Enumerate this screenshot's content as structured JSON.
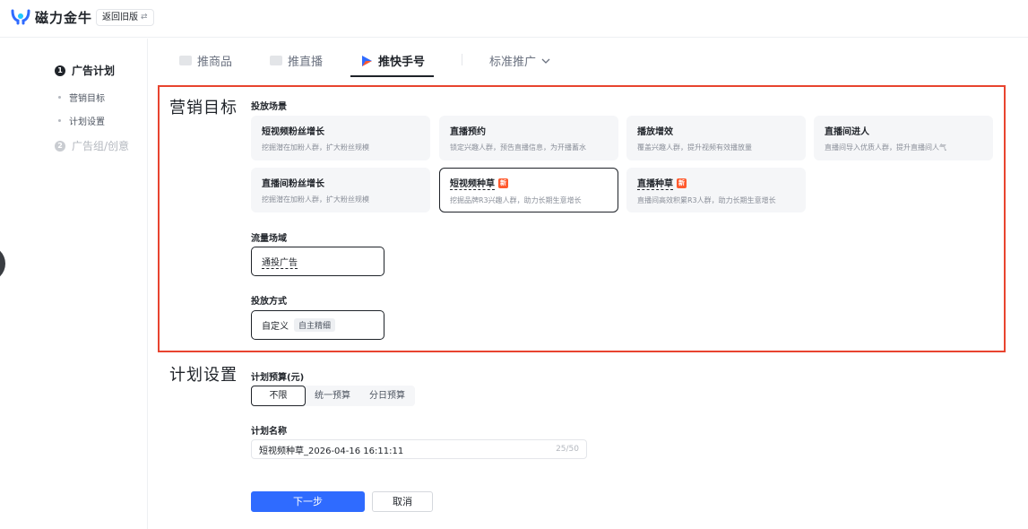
{
  "app": {
    "name": "磁力金牛",
    "back_old_label": "返回旧版",
    "swap_icon": "⇄"
  },
  "sidebar": {
    "step1": {
      "num": "1",
      "label": "广告计划"
    },
    "step1_items": [
      {
        "label": "营销目标"
      },
      {
        "label": "计划设置"
      }
    ],
    "step2": {
      "num": "2",
      "label": "广告组/创意"
    }
  },
  "tabs": [
    {
      "label": "推商品",
      "icon": "product-icon"
    },
    {
      "label": "推直播",
      "icon": "live-icon"
    },
    {
      "label": "推快手号",
      "icon": "kuaishou-icon"
    }
  ],
  "promo_mode": {
    "label": "标准推广",
    "icon": "chevron-down-icon"
  },
  "marketing_goal": {
    "title": "营销目标",
    "scene_label": "投放场景",
    "scenes": [
      {
        "title": "短视频粉丝增长",
        "desc": "挖掘潜在加粉人群，扩大粉丝规模",
        "new": ""
      },
      {
        "title": "直播预约",
        "desc": "锁定兴趣人群，预告直播信息，为开播蓄水",
        "new": ""
      },
      {
        "title": "播放增效",
        "desc": "覆盖兴趣人群，提升视频有效播放量",
        "new": ""
      },
      {
        "title": "直播间进人",
        "desc": "直播间导入优质人群，提升直播间人气",
        "new": ""
      },
      {
        "title": "直播间粉丝增长",
        "desc": "挖掘潜在加粉人群，扩大粉丝规模",
        "new": ""
      },
      {
        "title": "短视频种草",
        "desc": "挖掘品牌R3兴趣人群，助力长期生意增长",
        "new": "新"
      },
      {
        "title": "直播种草",
        "desc": "直播间高效积累R3人群，助力长期生意增长",
        "new": "新"
      }
    ],
    "traffic_label": "流量场域",
    "traffic_value": "通投广告",
    "delivery_label": "投放方式",
    "delivery_value": "自定义",
    "delivery_chip": "自主精细"
  },
  "plan_settings": {
    "title": "计划设置",
    "budget_label": "计划预算(元)",
    "budget_options": [
      "不限",
      "统一预算",
      "分日预算"
    ],
    "budget_selected": "不限",
    "name_label": "计划名称",
    "name_value": "短视频种草_2026-04-16 16:11:11",
    "name_count": "25/50"
  },
  "actions": {
    "next_label": "下一步",
    "cancel_label": "取消"
  },
  "colors": {
    "primary": "#2f6bff",
    "highlight": "#e8442f",
    "new_badge": "#ff5a2e"
  }
}
